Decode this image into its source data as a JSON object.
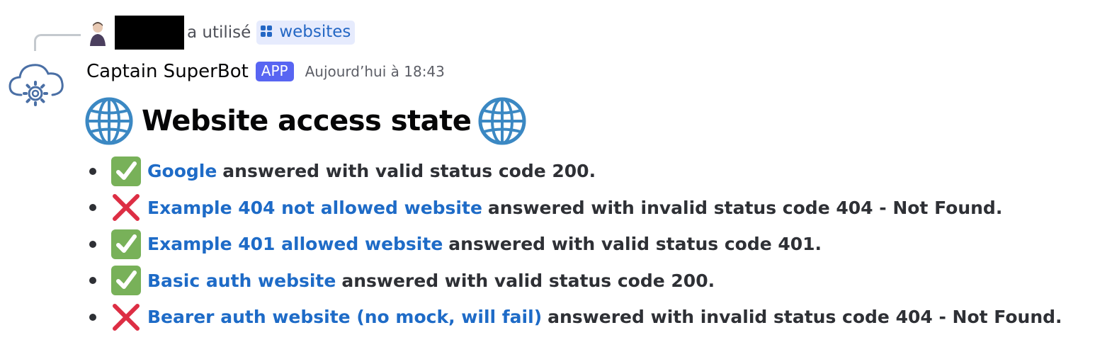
{
  "reply": {
    "used_text": "a utilisé",
    "command_name": "websites",
    "user_redacted": true
  },
  "message": {
    "author": "Captain SuperBot",
    "badge": "APP",
    "timestamp": "Aujourd’hui à 18:43"
  },
  "embed": {
    "title": "Website access state",
    "title_icon": "globe-icon",
    "items": [
      {
        "status": "success",
        "icon": "check-mark-icon",
        "site": "Google",
        "text": "answered with valid status code 200."
      },
      {
        "status": "fail",
        "icon": "cross-mark-icon",
        "site": "Example 404 not allowed website",
        "text": "answered with invalid status code 404 - Not Found."
      },
      {
        "status": "success",
        "icon": "check-mark-icon",
        "site": "Example 401 allowed website",
        "text": "answered with valid status code 401."
      },
      {
        "status": "success",
        "icon": "check-mark-icon",
        "site": "Basic auth website",
        "text": "answered with valid status code 200."
      },
      {
        "status": "fail",
        "icon": "cross-mark-icon",
        "site": "Bearer auth website (no mock, will fail)",
        "text": "answered with invalid status code 404 - Not Found."
      }
    ]
  },
  "colors": {
    "link": "#1e6bc7",
    "app_badge": "#5865f2",
    "success": "#78b159",
    "fail": "#dd2e44",
    "globe": "#3b88c3"
  }
}
